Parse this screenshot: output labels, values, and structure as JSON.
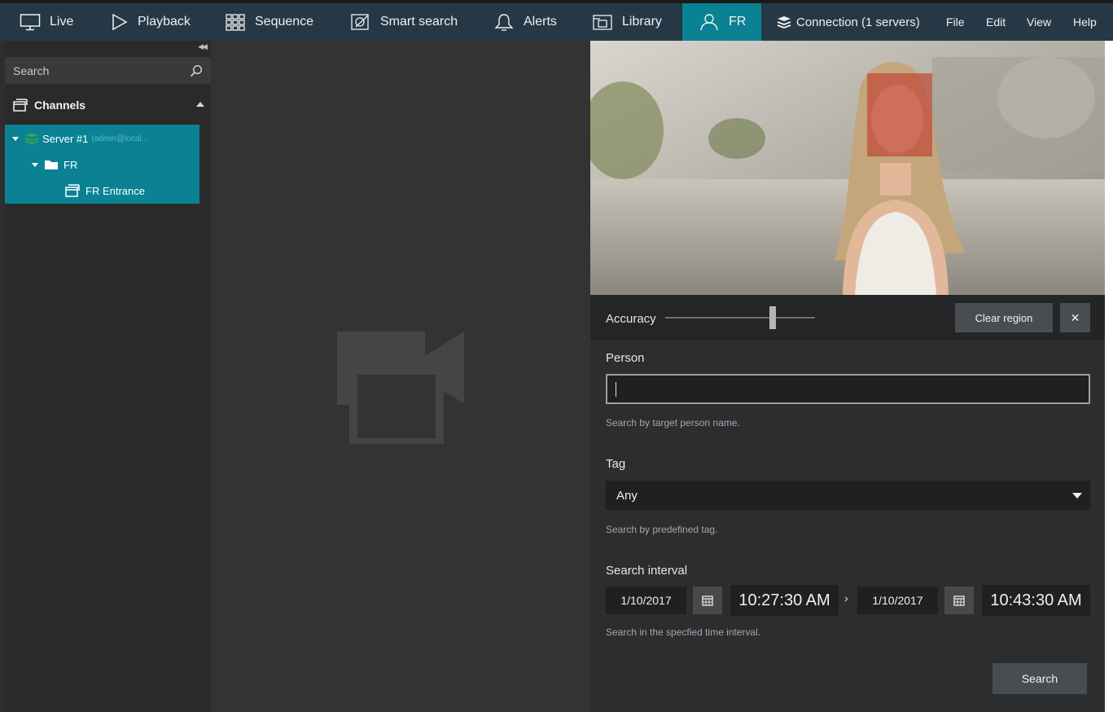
{
  "nav": {
    "live": "Live",
    "playback": "Playback",
    "sequence": "Sequence",
    "smart_search": "Smart search",
    "alerts": "Alerts",
    "library": "Library",
    "fr": "FR",
    "connection": "Connection (1 servers)",
    "file": "File",
    "edit": "Edit",
    "view": "View",
    "help": "Help"
  },
  "sidebar": {
    "search_placeholder": "Search",
    "channels_label": "Channels",
    "tree": {
      "server": "Server #1",
      "server_user": "(admin@local...",
      "folder": "FR",
      "channel": "FR Entrance"
    }
  },
  "fr_panel": {
    "accuracy_label": "Accuracy",
    "accuracy_value": 0.72,
    "clear_region": "Clear region",
    "close_symbol": "✕",
    "person_label": "Person",
    "person_value": "",
    "person_hint": "Search by target person name.",
    "tag_label": "Tag",
    "tag_value": "Any",
    "tag_hint": "Search by predefined tag.",
    "interval_label": "Search interval",
    "start_date": "1/10/2017",
    "start_time": "10:27:30 AM",
    "end_date": "1/10/2017",
    "end_time": "10:43:30 AM",
    "interval_hint": "Search in the specfied time interval.",
    "search_button": "Search"
  },
  "colors": {
    "accent": "#0a8294",
    "topbar": "#263845",
    "face_region": "#c0392b"
  }
}
